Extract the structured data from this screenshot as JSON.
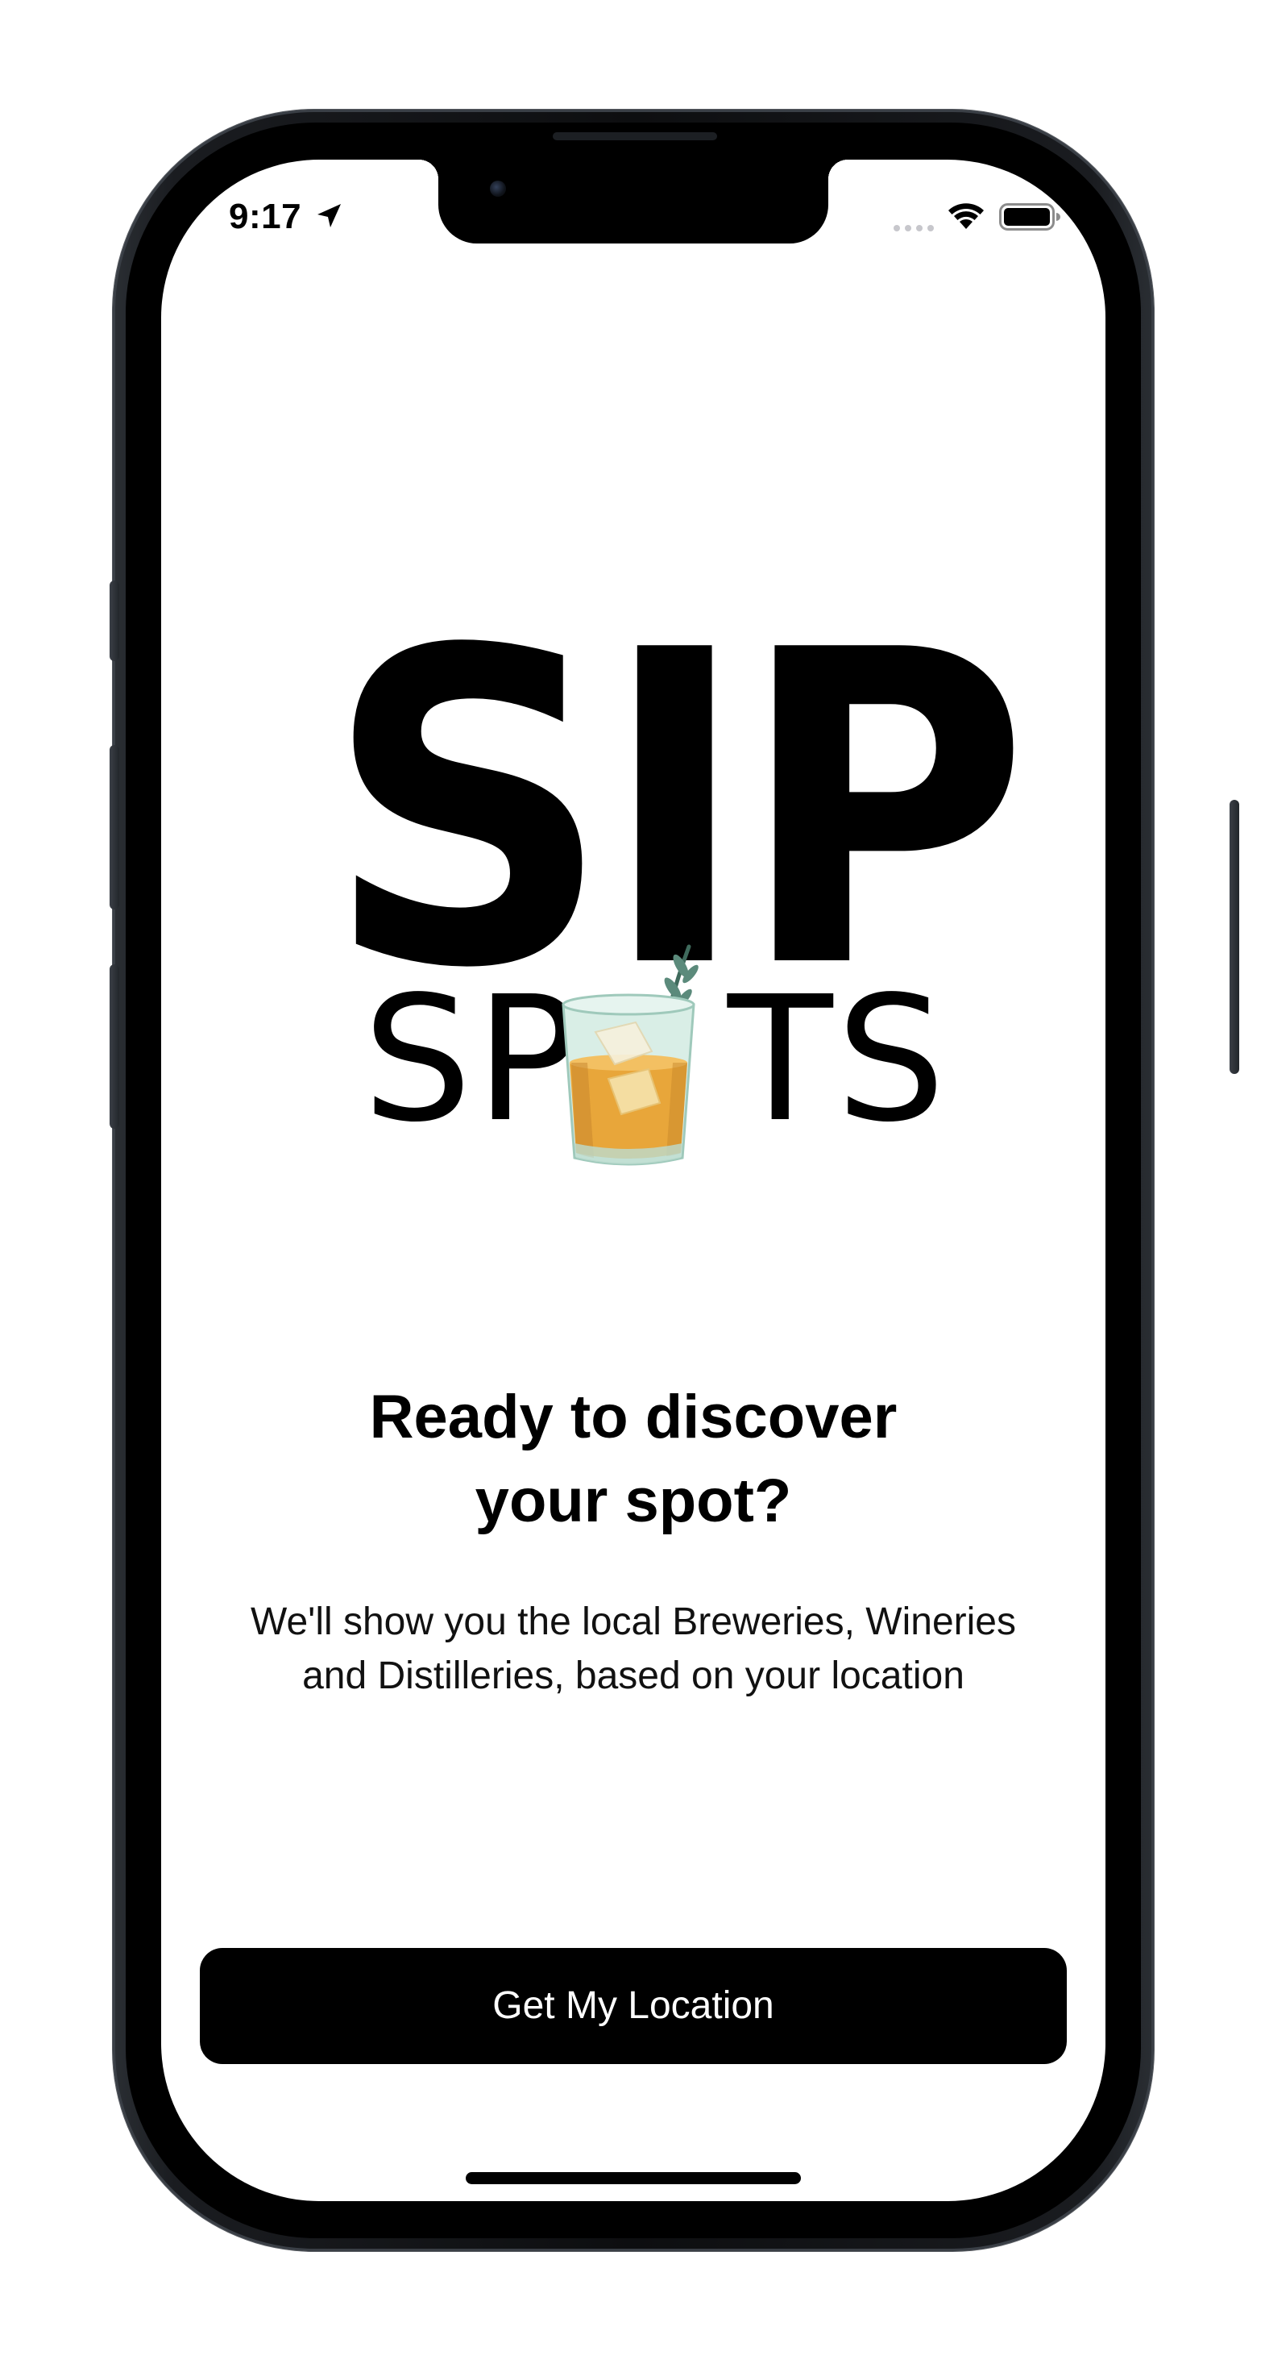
{
  "status_bar": {
    "time": "9:17",
    "location_icon": "location-arrow-icon",
    "signal_icon": "cellular-signal-icon",
    "wifi_icon": "wifi-icon",
    "battery_icon": "battery-icon"
  },
  "logo": {
    "line1": "SIP",
    "line2_left": "SP",
    "line2_right": "TS",
    "glass_icon": "whiskey-glass-icon"
  },
  "onboarding": {
    "headline_line1": "Ready to discover",
    "headline_line2": "your spot?",
    "body_line1": "We'll show you the local Breweries, Wineries",
    "body_line2": "and Distilleries, based on your location",
    "cta_label": "Get My Location"
  },
  "colors": {
    "text": "#000000",
    "button_background": "#000000",
    "button_text": "#ffffff",
    "screen_background": "#ffffff",
    "glass_liquid": "#e8a63a",
    "glass_tint": "#bfe0d4",
    "rosemary": "#4f7a6e"
  }
}
